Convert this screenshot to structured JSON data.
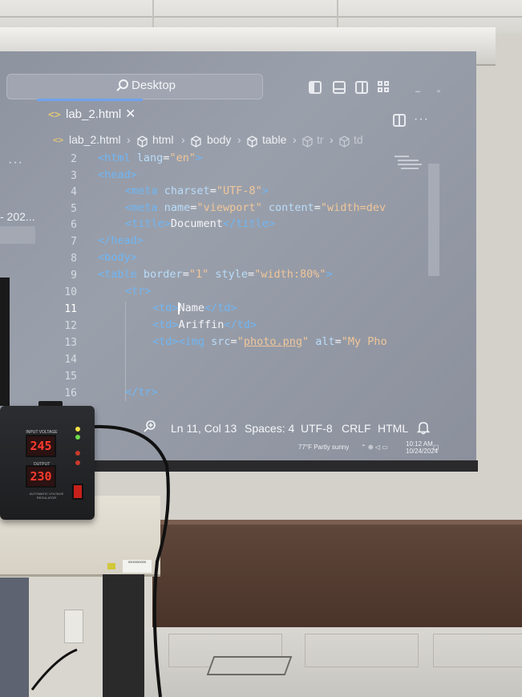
{
  "titlebar": {
    "search_placeholder": "Desktop",
    "window_controls": [
      "–",
      "▫",
      "×"
    ]
  },
  "tabs": [
    {
      "label": "lab_2.html",
      "icon": "html-file-icon",
      "active": true
    }
  ],
  "left_more": "···",
  "right_more": "···",
  "breadcrumb": {
    "items": [
      "lab_2.html",
      "html",
      "body",
      "table",
      "tr",
      "td"
    ]
  },
  "sidebar": {
    "partial_text": "- 202..."
  },
  "editor": {
    "active_line": 11,
    "lines": [
      {
        "num": "2"
      },
      {
        "num": "3"
      },
      {
        "num": "4"
      },
      {
        "num": "5"
      },
      {
        "num": "6"
      },
      {
        "num": "7"
      },
      {
        "num": "8"
      },
      {
        "num": "9"
      },
      {
        "num": "10"
      },
      {
        "num": "11"
      },
      {
        "num": "12"
      },
      {
        "num": "13"
      },
      {
        "num": "14"
      },
      {
        "num": "15"
      },
      {
        "num": "16"
      }
    ],
    "code": {
      "l2": [
        "<html ",
        "lang",
        "=",
        "\"en\"",
        ">"
      ],
      "l3": [
        "<head>"
      ],
      "l4": [
        "<meta ",
        "charset",
        "=",
        "\"UTF-8\"",
        ">"
      ],
      "l5": [
        "<meta ",
        "name",
        "=",
        "\"viewport\"",
        " ",
        "content",
        "=",
        "\"width=dev"
      ],
      "l6": [
        "<title>",
        "Document",
        "</title>"
      ],
      "l7": [
        "</head>"
      ],
      "l8": [
        "<body>"
      ],
      "l9": [
        "<table ",
        "border",
        "=",
        "\"1\"",
        " ",
        "style",
        "=",
        "\"width:80%\"",
        ">"
      ],
      "l10": [
        "<tr>"
      ],
      "l11": [
        "<td>",
        "Name",
        "</td>"
      ],
      "l12": [
        "<td>",
        "Ariffin",
        "</td>"
      ],
      "l13": [
        "<td>",
        "<img ",
        "src",
        "=",
        "\"",
        "photo.png",
        "\"",
        " ",
        "alt",
        "=",
        "\"My Pho"
      ],
      "l16": [
        "</tr>"
      ]
    }
  },
  "statusbar": {
    "position": "Ln 11, Col 13",
    "spaces": "Spaces: 4",
    "encoding": "UTF-8",
    "eol": "CRLF",
    "language": "HTML"
  },
  "taskbar": {
    "weather": "77°F  Partly sunny",
    "time": "10:12 AM",
    "date": "10/24/2024"
  },
  "device": {
    "input_voltage": "245",
    "output_voltage": "230",
    "input_label": "INPUT VOLTAGE",
    "output_label": "OUTPUT VOLTAGE",
    "bottom_label": "AUTOMATIC VOLTAGE REGULATOR"
  },
  "desk": {
    "sticker": "0000000000"
  },
  "colors": {
    "tag": "#6fb6f5",
    "attribute": "#b9dcfb",
    "string": "#f0c69a",
    "text": "#f4f5f8",
    "led_red": "#ff3b2e",
    "tab_underline": "#6fa2ee"
  }
}
